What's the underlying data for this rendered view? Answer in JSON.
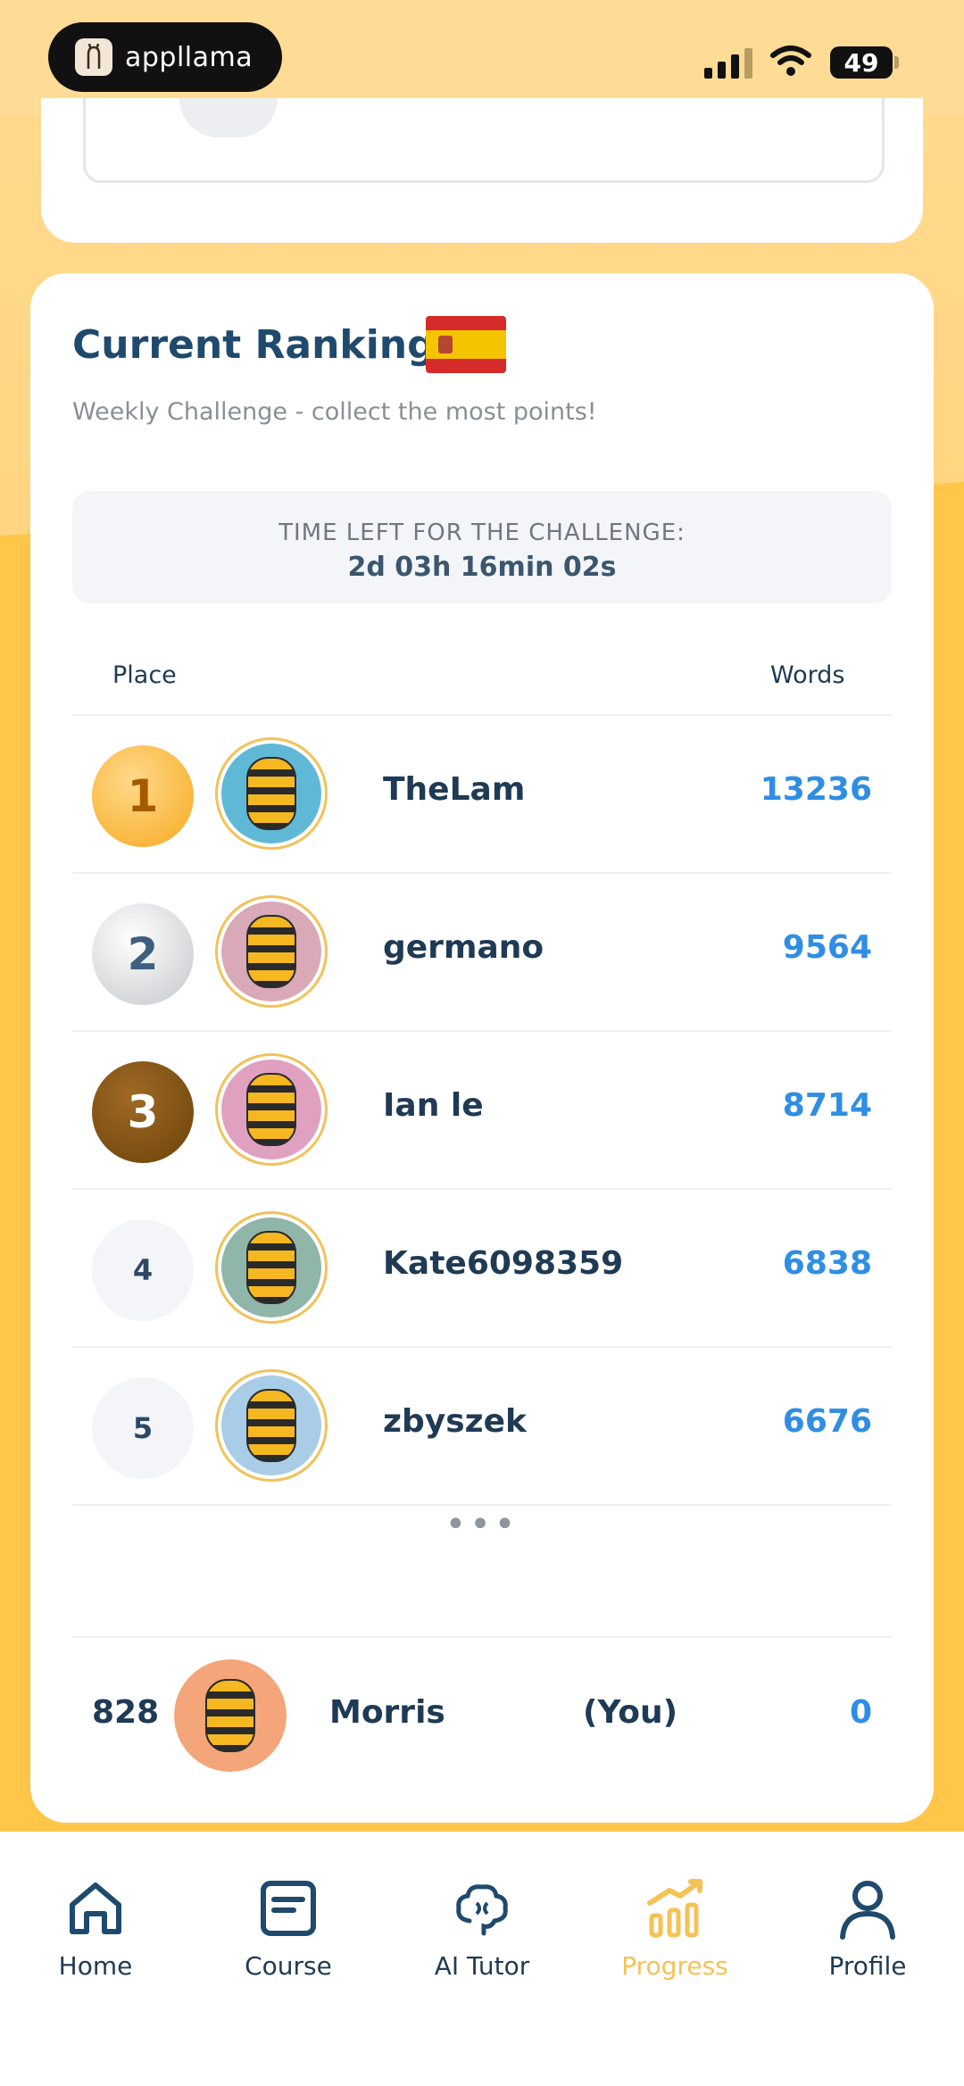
{
  "status_bar": {
    "brand": "appllama",
    "battery": "49"
  },
  "ranking": {
    "title": "Current Ranking",
    "subtitle": "Weekly Challenge - collect the most points!",
    "timer_label": "TIME LEFT FOR THE CHALLENGE:",
    "timer_value": "2d 03h 16min 02s",
    "col_place": "Place",
    "col_words": "Words",
    "rows": [
      {
        "place": "1",
        "name": "TheLam",
        "score": "13236"
      },
      {
        "place": "2",
        "name": "germano",
        "score": "9564"
      },
      {
        "place": "3",
        "name": "Ian le",
        "score": "8714"
      },
      {
        "place": "4",
        "name": "Kate6098359",
        "score": "6838"
      },
      {
        "place": "5",
        "name": "zbyszek",
        "score": "6676"
      }
    ],
    "more": "•••",
    "me": {
      "place": "828",
      "name": "Morris",
      "tag": "(You)",
      "score": "0"
    }
  },
  "nav": {
    "items": [
      {
        "label": "Home",
        "icon": "home-icon"
      },
      {
        "label": "Course",
        "icon": "course-icon"
      },
      {
        "label": "AI Tutor",
        "icon": "brain-icon"
      },
      {
        "label": "Progress",
        "icon": "chart-icon"
      },
      {
        "label": "Profile",
        "icon": "person-icon"
      }
    ],
    "active": "Progress",
    "active_color": "#f6c256"
  },
  "colors": {
    "accent_blue": "#2f8ee4",
    "text_dark": "#1f3a54",
    "background": "#ffc64a"
  }
}
